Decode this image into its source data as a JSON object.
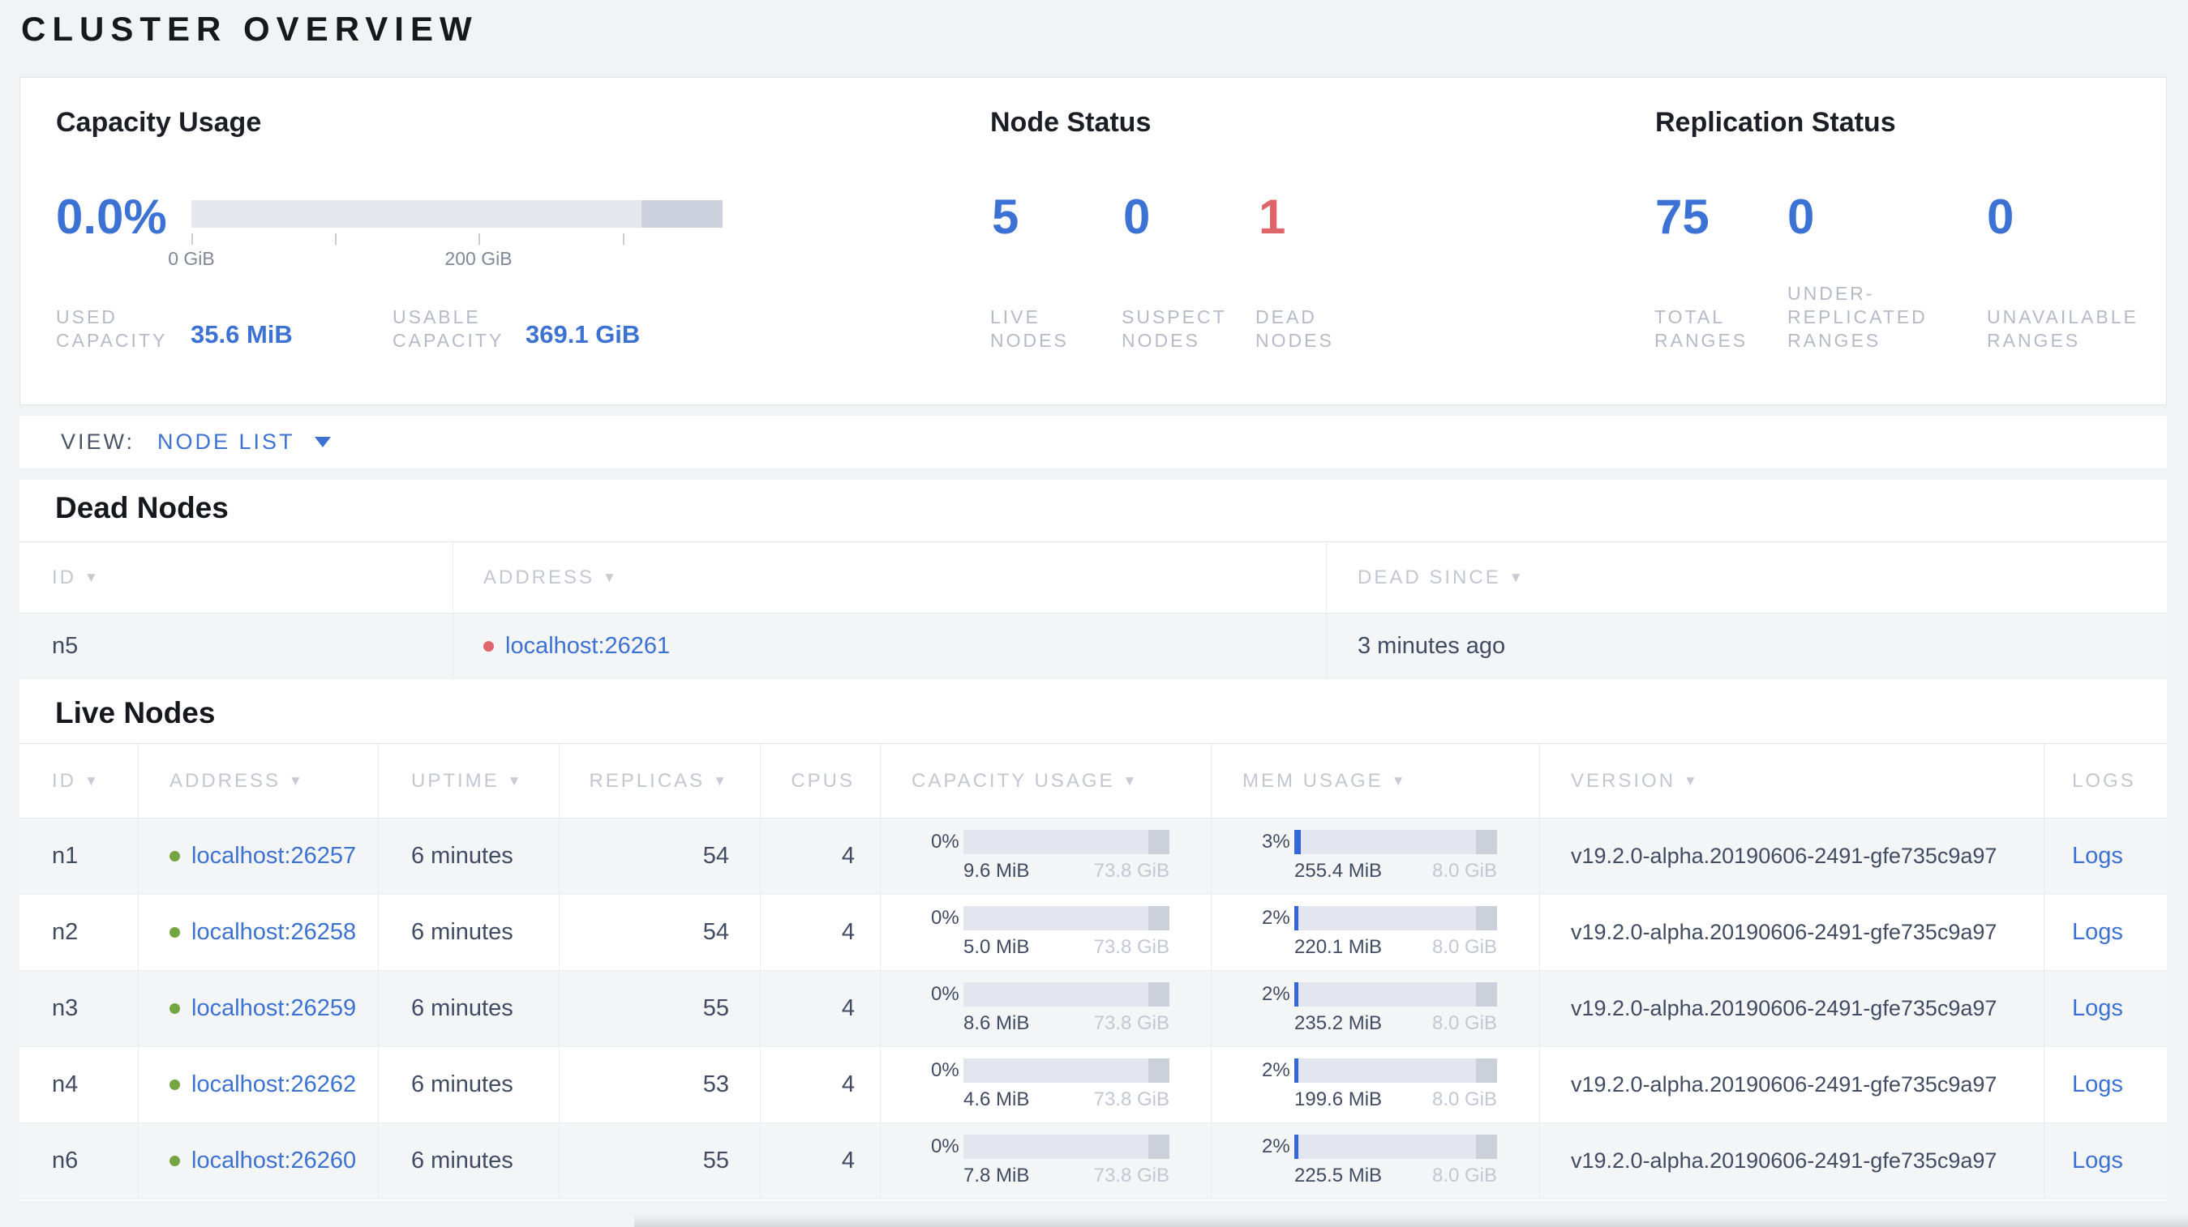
{
  "colors": {
    "accent_blue": "#3c72d4",
    "alert_red": "#e0656a",
    "live_green": "#73a540"
  },
  "icons": {
    "sort_arrow": "▼"
  },
  "page": {
    "title": "CLUSTER OVERVIEW"
  },
  "summary": {
    "capacity": {
      "heading": "Capacity Usage",
      "percent": "0.0%",
      "axis_ticks": [
        "0 GiB",
        "200 GiB"
      ],
      "stats": [
        {
          "label": "USED CAPACITY",
          "value": "35.6 MiB"
        },
        {
          "label": "USABLE CAPACITY",
          "value": "369.1 GiB"
        }
      ]
    },
    "node_status": {
      "heading": "Node Status",
      "stats": [
        {
          "value": "5",
          "label": "LIVE NODES",
          "tone": "blue"
        },
        {
          "value": "0",
          "label": "SUSPECT NODES",
          "tone": "blue"
        },
        {
          "value": "1",
          "label": "DEAD NODES",
          "tone": "red"
        }
      ]
    },
    "replication": {
      "heading": "Replication Status",
      "stats": [
        {
          "value": "75",
          "label": "TOTAL RANGES",
          "tone": "blue"
        },
        {
          "value": "0",
          "label": "UNDER-REPLICATED RANGES",
          "tone": "blue"
        },
        {
          "value": "0",
          "label": "UNAVAILABLE RANGES",
          "tone": "blue"
        }
      ]
    }
  },
  "view_bar": {
    "label": "VIEW:",
    "selected": "NODE LIST"
  },
  "dead_nodes": {
    "heading": "Dead Nodes",
    "columns": [
      {
        "label": "ID",
        "sortable": true
      },
      {
        "label": "ADDRESS",
        "sortable": true
      },
      {
        "label": "DEAD SINCE",
        "sortable": true
      }
    ],
    "rows": [
      {
        "id": "n5",
        "address": "localhost:26261",
        "dead_since": "3 minutes ago"
      }
    ]
  },
  "live_nodes": {
    "heading": "Live Nodes",
    "columns": [
      {
        "label": "ID",
        "sortable": true
      },
      {
        "label": "ADDRESS",
        "sortable": true
      },
      {
        "label": "UPTIME",
        "sortable": true
      },
      {
        "label": "REPLICAS",
        "sortable": true
      },
      {
        "label": "CPUS",
        "sortable": false
      },
      {
        "label": "CAPACITY USAGE",
        "sortable": true
      },
      {
        "label": "MEM USAGE",
        "sortable": true
      },
      {
        "label": "VERSION",
        "sortable": true
      },
      {
        "label": "LOGS",
        "sortable": false
      }
    ],
    "rows": [
      {
        "id": "n1",
        "address": "localhost:26257",
        "uptime": "6 minutes",
        "replicas": "54",
        "cpus": "4",
        "capacity": {
          "percent": "0%",
          "used": "9.6 MiB",
          "total": "73.8 GiB",
          "fill_pct": 0
        },
        "mem": {
          "percent": "3%",
          "used": "255.4 MiB",
          "total": "8.0 GiB",
          "fill_pct": 3
        },
        "version": "v19.2.0-alpha.20190606-2491-gfe735c9a97",
        "logs": "Logs"
      },
      {
        "id": "n2",
        "address": "localhost:26258",
        "uptime": "6 minutes",
        "replicas": "54",
        "cpus": "4",
        "capacity": {
          "percent": "0%",
          "used": "5.0 MiB",
          "total": "73.8 GiB",
          "fill_pct": 0
        },
        "mem": {
          "percent": "2%",
          "used": "220.1 MiB",
          "total": "8.0 GiB",
          "fill_pct": 2
        },
        "version": "v19.2.0-alpha.20190606-2491-gfe735c9a97",
        "logs": "Logs"
      },
      {
        "id": "n3",
        "address": "localhost:26259",
        "uptime": "6 minutes",
        "replicas": "55",
        "cpus": "4",
        "capacity": {
          "percent": "0%",
          "used": "8.6 MiB",
          "total": "73.8 GiB",
          "fill_pct": 0
        },
        "mem": {
          "percent": "2%",
          "used": "235.2 MiB",
          "total": "8.0 GiB",
          "fill_pct": 2
        },
        "version": "v19.2.0-alpha.20190606-2491-gfe735c9a97",
        "logs": "Logs"
      },
      {
        "id": "n4",
        "address": "localhost:26262",
        "uptime": "6 minutes",
        "replicas": "53",
        "cpus": "4",
        "capacity": {
          "percent": "0%",
          "used": "4.6 MiB",
          "total": "73.8 GiB",
          "fill_pct": 0
        },
        "mem": {
          "percent": "2%",
          "used": "199.6 MiB",
          "total": "8.0 GiB",
          "fill_pct": 2
        },
        "version": "v19.2.0-alpha.20190606-2491-gfe735c9a97",
        "logs": "Logs"
      },
      {
        "id": "n6",
        "address": "localhost:26260",
        "uptime": "6 minutes",
        "replicas": "55",
        "cpus": "4",
        "capacity": {
          "percent": "0%",
          "used": "7.8 MiB",
          "total": "73.8 GiB",
          "fill_pct": 0
        },
        "mem": {
          "percent": "2%",
          "used": "225.5 MiB",
          "total": "8.0 GiB",
          "fill_pct": 2
        },
        "version": "v19.2.0-alpha.20190606-2491-gfe735c9a97",
        "logs": "Logs"
      }
    ]
  }
}
